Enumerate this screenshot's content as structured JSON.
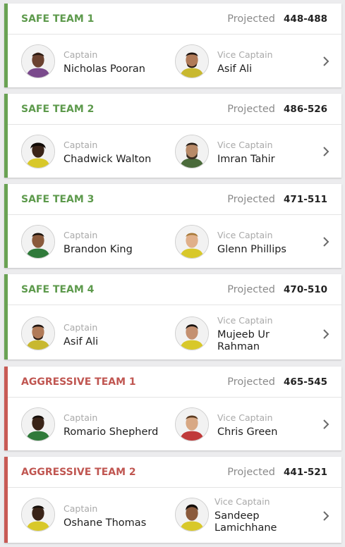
{
  "labels": {
    "projected": "Projected",
    "captain": "Captain",
    "vice_captain": "Vice Captain"
  },
  "colors": {
    "safe_accent": "#6aa254",
    "aggressive_accent": "#c85a55"
  },
  "teams": [
    {
      "name": "SAFE TEAM 1",
      "type": "safe",
      "projected": "448-488",
      "captain": "Nicholas Pooran",
      "vice_captain": "Asif Ali"
    },
    {
      "name": "SAFE TEAM 2",
      "type": "safe",
      "projected": "486-526",
      "captain": "Chadwick Walton",
      "vice_captain": "Imran Tahir"
    },
    {
      "name": "SAFE TEAM 3",
      "type": "safe",
      "projected": "471-511",
      "captain": "Brandon King",
      "vice_captain": "Glenn Phillips"
    },
    {
      "name": "SAFE TEAM 4",
      "type": "safe",
      "projected": "470-510",
      "captain": "Asif Ali",
      "vice_captain": "Mujeeb Ur Rahman"
    },
    {
      "name": "AGGRESSIVE TEAM 1",
      "type": "aggressive",
      "projected": "465-545",
      "captain": "Romario Shepherd",
      "vice_captain": "Chris Green"
    },
    {
      "name": "AGGRESSIVE TEAM 2",
      "type": "aggressive",
      "projected": "441-521",
      "captain": "Oshane Thomas",
      "vice_captain": "Sandeep Lamichhane"
    }
  ]
}
